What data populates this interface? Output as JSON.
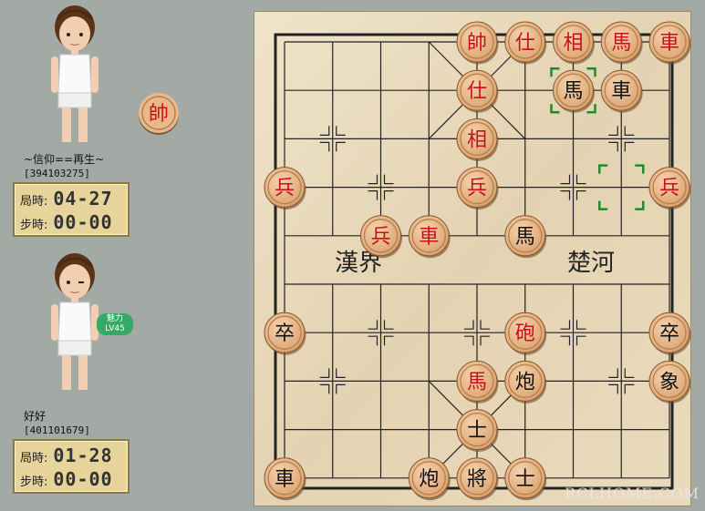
{
  "players": [
    {
      "name": "~信仰==再生~",
      "id": "[394103275]",
      "game_time_label": "局時:",
      "game_time": "04-27",
      "step_time_label": "步時:",
      "step_time": "00-00",
      "side_piece": "帥"
    },
    {
      "name": "好好",
      "id": "[401101679]",
      "game_time_label": "局時:",
      "game_time": "01-28",
      "step_time_label": "步時:",
      "step_time": "00-00",
      "badge": "魅力 LV45"
    }
  ],
  "board": {
    "river_left": "漢界",
    "river_right": "楚河",
    "colors": {
      "red": "#c8101a",
      "black": "#111111",
      "board": "#e9dbc0",
      "line": "#222222",
      "highlight": "#1f8a2a"
    },
    "pieces": [
      {
        "t": "帥",
        "c": "red",
        "col": 4,
        "row": 0
      },
      {
        "t": "仕",
        "c": "red",
        "col": 5,
        "row": 0
      },
      {
        "t": "相",
        "c": "red",
        "col": 6,
        "row": 0
      },
      {
        "t": "馬",
        "c": "red",
        "col": 7,
        "row": 0
      },
      {
        "t": "車",
        "c": "red",
        "col": 8,
        "row": 0
      },
      {
        "t": "仕",
        "c": "red",
        "col": 4,
        "row": 1
      },
      {
        "t": "馬",
        "c": "black",
        "col": 6,
        "row": 1
      },
      {
        "t": "車",
        "c": "black",
        "col": 7,
        "row": 1
      },
      {
        "t": "相",
        "c": "red",
        "col": 4,
        "row": 2
      },
      {
        "t": "兵",
        "c": "red",
        "col": 0,
        "row": 3
      },
      {
        "t": "兵",
        "c": "red",
        "col": 4,
        "row": 3
      },
      {
        "t": "兵",
        "c": "red",
        "col": 8,
        "row": 3
      },
      {
        "t": "兵",
        "c": "red",
        "col": 2,
        "row": 4
      },
      {
        "t": "車",
        "c": "red",
        "col": 3,
        "row": 4
      },
      {
        "t": "馬",
        "c": "black",
        "col": 5,
        "row": 4
      },
      {
        "t": "卒",
        "c": "black",
        "col": 0,
        "row": 6
      },
      {
        "t": "砲",
        "c": "red",
        "col": 5,
        "row": 6
      },
      {
        "t": "卒",
        "c": "black",
        "col": 8,
        "row": 6
      },
      {
        "t": "馬",
        "c": "red",
        "col": 4,
        "row": 7
      },
      {
        "t": "炮",
        "c": "black",
        "col": 5,
        "row": 7
      },
      {
        "t": "象",
        "c": "black",
        "col": 8,
        "row": 7
      },
      {
        "t": "士",
        "c": "black",
        "col": 4,
        "row": 8
      },
      {
        "t": "車",
        "c": "black",
        "col": 0,
        "row": 9
      },
      {
        "t": "炮",
        "c": "black",
        "col": 3,
        "row": 9
      },
      {
        "t": "將",
        "c": "black",
        "col": 4,
        "row": 9
      },
      {
        "t": "士",
        "c": "black",
        "col": 5,
        "row": 9
      }
    ],
    "markers": [
      {
        "name": "last-move-to",
        "col": 6,
        "row": 1
      },
      {
        "name": "last-move-from",
        "col": 7,
        "row": 3
      }
    ],
    "cross_marks": [
      [
        1,
        2
      ],
      [
        7,
        2
      ],
      [
        2,
        3
      ],
      [
        6,
        3
      ],
      [
        2,
        6
      ],
      [
        4,
        6
      ],
      [
        6,
        6
      ],
      [
        1,
        7
      ],
      [
        7,
        7
      ]
    ]
  },
  "watermark": "RCLHOME.COM"
}
